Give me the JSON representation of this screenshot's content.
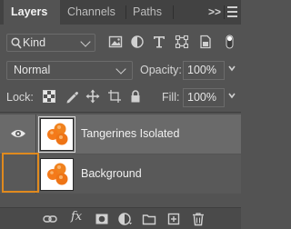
{
  "tabs": [
    {
      "label": "Layers",
      "active": true
    },
    {
      "label": "Channels",
      "active": false
    },
    {
      "label": "Paths",
      "active": false
    }
  ],
  "tab_expand_label": ">>",
  "filter": {
    "kind_label": "Kind"
  },
  "blend": {
    "mode": "Normal",
    "opacity_label": "Opacity:",
    "opacity_value": "100%"
  },
  "lock": {
    "label": "Lock:",
    "fill_label": "Fill:",
    "fill_value": "100%"
  },
  "layers": [
    {
      "name": "Tangerines Isolated",
      "visible": true,
      "selected": true
    },
    {
      "name": "Background",
      "visible": false,
      "selected": false
    }
  ],
  "bottom": {
    "fx_label": "fx"
  },
  "colors": {
    "highlight": "#e08a1e",
    "panel": "#535353",
    "selected_row": "#6a6a6a"
  }
}
